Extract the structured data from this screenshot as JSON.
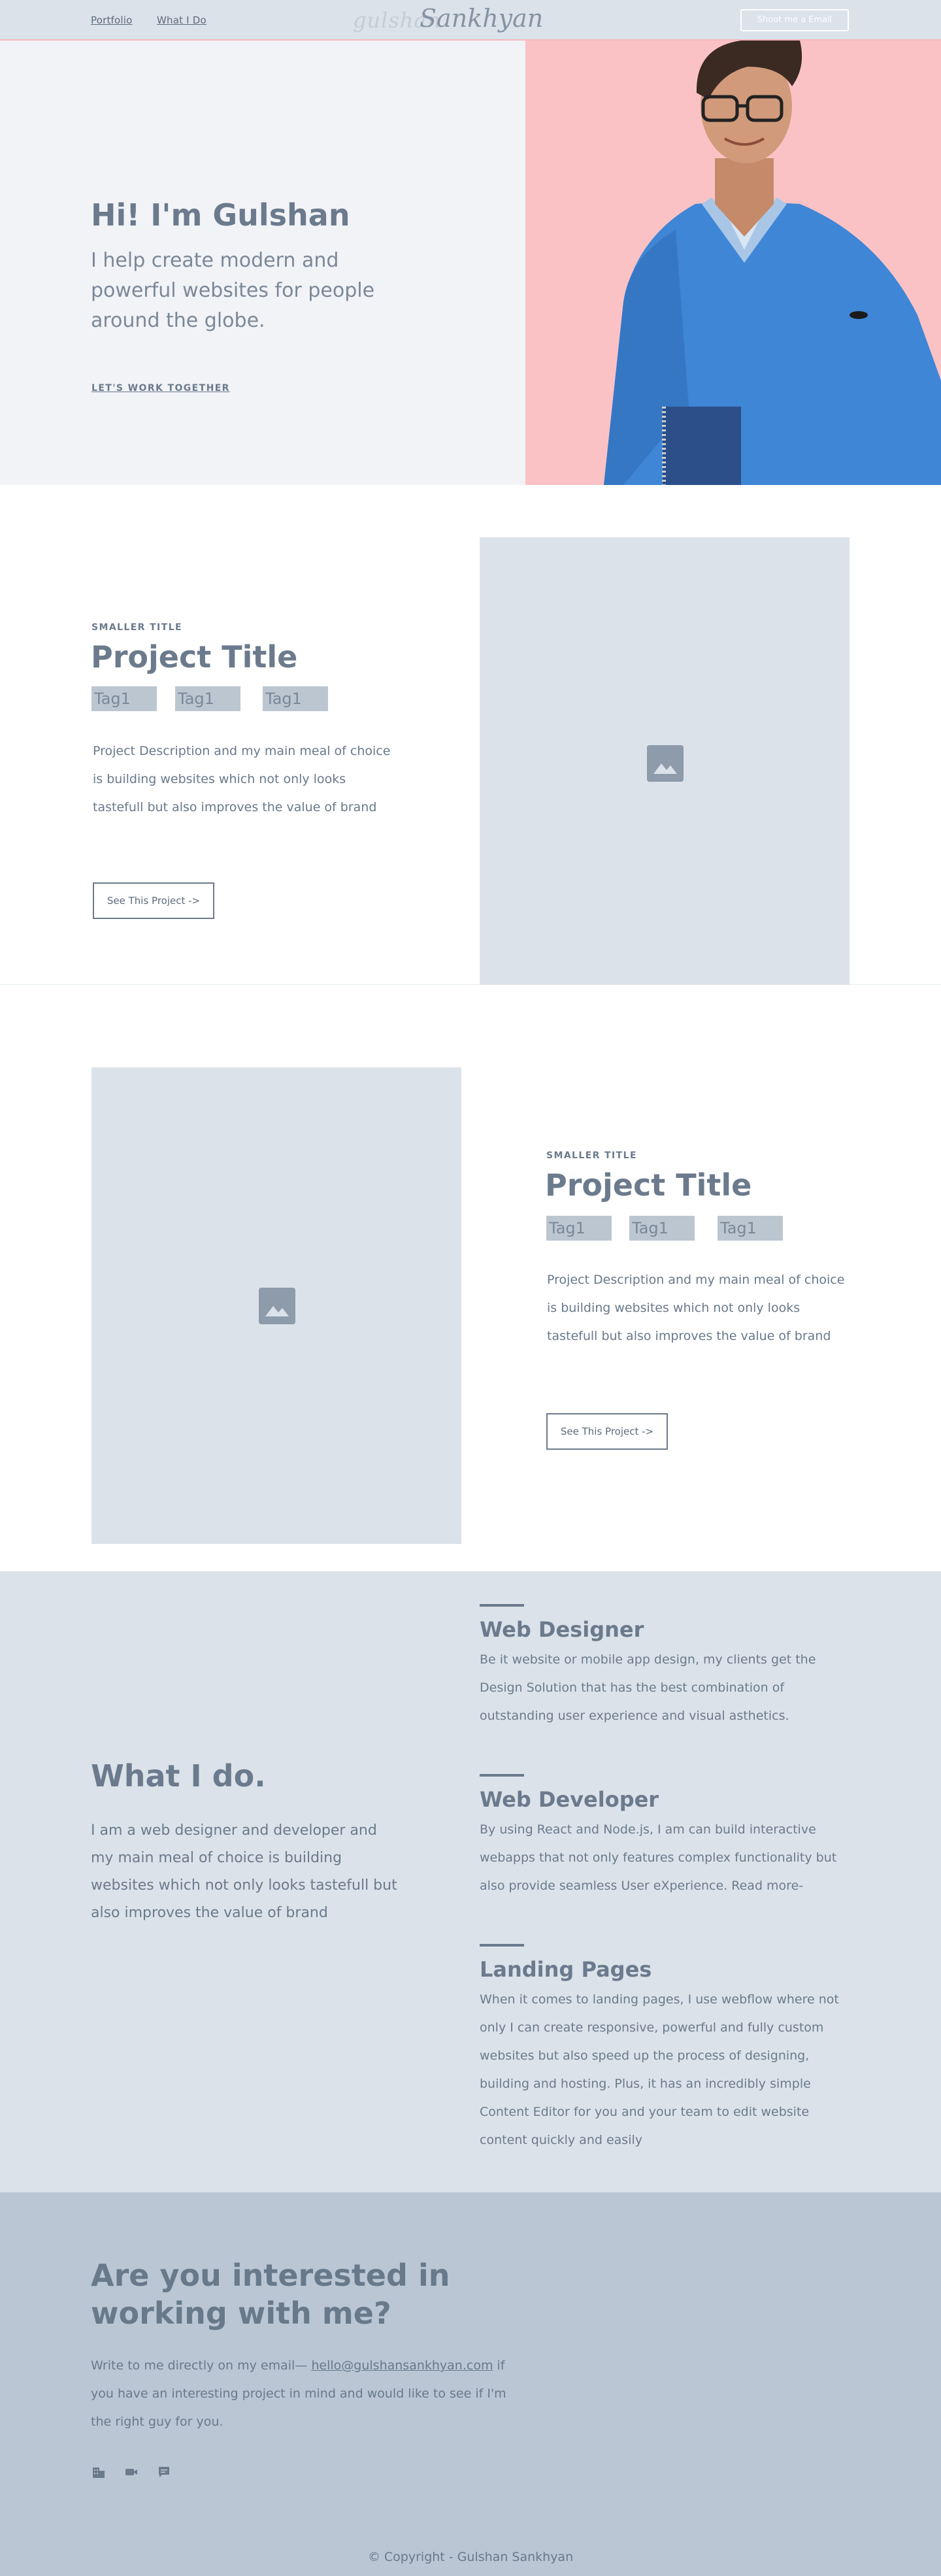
{
  "nav": {
    "links": [
      "Portfolio",
      "What I Do"
    ],
    "logo_first": "gulshan",
    "logo_last": "Sankhyan",
    "email_button": "Shoot me a Email"
  },
  "hero": {
    "title": "Hi! I'm Gulshan",
    "subtitle": "I help create modern and powerful websites for people around the globe.",
    "cta": "LET'S WORK TOGETHER",
    "accent_color": "#fbc2c6"
  },
  "projects": [
    {
      "small_title": "SMALLER TITLE",
      "title": "Project Title",
      "tags": [
        "Tag1",
        "Tag1",
        "Tag1"
      ],
      "description": "Project Description and my main meal of choice is building  websites which not only looks tastefull but also improves the value of brand",
      "button": "See This Project ->"
    },
    {
      "small_title": "SMALLER TITLE",
      "title": "Project Title",
      "tags": [
        "Tag1",
        "Tag1",
        "Tag1"
      ],
      "description": "Project Description and my main meal of choice is building  websites which not only looks tastefull but also improves the value of brand",
      "button": "See This Project ->"
    }
  ],
  "what_i_do": {
    "title": "What I do.",
    "description": "I am a web designer and developer and my main meal of choice is building websites which not only looks tastefull but also improves the value of brand",
    "services": [
      {
        "title": "Web Designer",
        "description": "Be it website or mobile app design, my clients get the Design Solution that has the best combination of outstanding user experience and visual asthetics."
      },
      {
        "title": "Web Developer",
        "description": "By using React and Node.js, I am can build interactive webapps that not only features complex functionality but also provide seamless User eXperience. Read more-"
      },
      {
        "title": "Landing Pages",
        "description": "When it comes to landing pages, I use webflow where not only I can create responsive, powerful and fully custom websites but also speed up the process of designing, building and hosting. Plus, it has an incredibly simple Content Editor for you and your team to edit website content quickly and easily"
      }
    ]
  },
  "contact": {
    "title": "Are you interested in working with me?",
    "text_before": "Write to me directly on my email— ",
    "email": "hello@gulshansankhyan.com",
    "text_after": " if you have an interesting project in mind and would like to see if I'm the right guy for you.",
    "social_icons": [
      "building-icon",
      "video-icon",
      "chat-icon"
    ]
  },
  "footer": {
    "copyright": "© Copyright - Gulshan Sankhyan"
  }
}
